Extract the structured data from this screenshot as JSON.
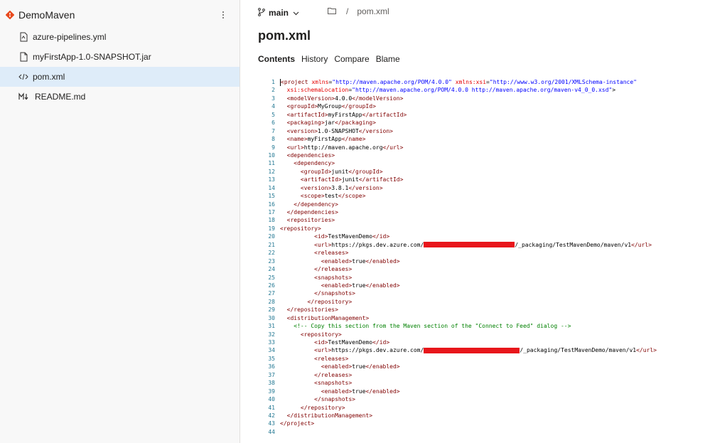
{
  "sidebar": {
    "repo_name": "DemoMaven",
    "files": [
      {
        "name": "azure-pipelines.yml",
        "icon": "pipeline-file-icon"
      },
      {
        "name": "myFirstApp-1.0-SNAPSHOT.jar",
        "icon": "file-icon"
      },
      {
        "name": "pom.xml",
        "icon": "code-file-icon",
        "selected": true
      },
      {
        "name": "README.md",
        "icon": "markdown-icon"
      }
    ]
  },
  "header": {
    "branch": "main",
    "breadcrumb_sep": "/",
    "breadcrumb_file": "pom.xml",
    "title": "pom.xml",
    "tabs": [
      "Contents",
      "History",
      "Compare",
      "Blame"
    ]
  },
  "code": {
    "line_numbers": [
      "1",
      "2",
      "3",
      "4",
      "5",
      "6",
      "7",
      "8",
      "9",
      "10",
      "11",
      "12",
      "13",
      "14",
      "15",
      "16",
      "17",
      "18",
      "19",
      "20",
      "21",
      "22",
      "23",
      "24",
      "25",
      "26",
      "27",
      "28",
      "29",
      "30",
      "31",
      "32",
      "33",
      "34",
      "35",
      "36",
      "37",
      "38",
      "39",
      "40",
      "41",
      "42",
      "43",
      "44"
    ],
    "lines": [
      "<project xmlns=\"http://maven.apache.org/POM/4.0.0\" xmlns:xsi=\"http://www.w3.org/2001/XMLSchema-instance\"",
      "  xsi:schemaLocation=\"http://maven.apache.org/POM/4.0.0 http://maven.apache.org/maven-v4_0_0.xsd\">",
      "  <modelVersion>4.0.0</modelVersion>",
      "  <groupId>MyGroup</groupId>",
      "  <artifactId>myFirstApp</artifactId>",
      "  <packaging>jar</packaging>",
      "  <version>1.0-SNAPSHOT</version>",
      "  <name>myFirstApp</name>",
      "  <url>http://maven.apache.org</url>",
      "  <dependencies>",
      "    <dependency>",
      "      <groupId>junit</groupId>",
      "      <artifactId>junit</artifactId>",
      "      <version>3.8.1</version>",
      "      <scope>test</scope>",
      "    </dependency>",
      "  </dependencies>",
      "  <repositories>",
      "<repository>",
      "          <id>TestMavenDemo</id>",
      "          <url>https://pkgs.dev.azure.com/",
      "          <releases>",
      "            <enabled>true</enabled>",
      "          </releases>",
      "          <snapshots>",
      "            <enabled>true</enabled>",
      "          </snapshots>",
      "        </repository>",
      "  </repositories>",
      "  <distributionManagement>",
      "    <!-- Copy this section from the Maven section of the \"Connect to Feed\" dialog -->",
      "      <repository>",
      "          <id>TestMavenDemo</id>",
      "          <url>https://pkgs.dev.azure.com/",
      "          <releases>",
      "            <enabled>true</enabled>",
      "          </releases>",
      "          <snapshots>",
      "            <enabled>true</enabled>",
      "          </snapshots>",
      "      </repository>",
      "  </distributionManagement>",
      "</project>",
      ""
    ],
    "url_suffix": "/_packaging/TestMavenDemo/maven/v1</url>"
  },
  "colors": {
    "accent": "#0078d4",
    "selected_bg": "#deecf9",
    "tag": "#800000",
    "attr": "#e50000",
    "value": "#0000ff",
    "comment": "#008000",
    "line_number": "#237893",
    "redaction": "#e8161b",
    "repo_icon": "#e8491d"
  }
}
